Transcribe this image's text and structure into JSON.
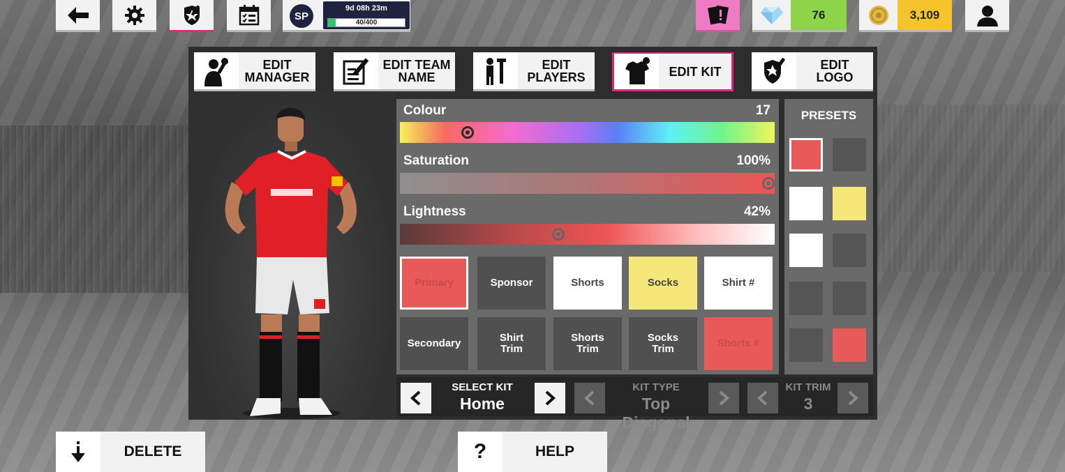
{
  "topbar": {
    "season_badge": "SP",
    "season_time": "9d 08h 23m",
    "season_progress_text": "40/400",
    "season_progress_fraction": 0.1,
    "gems": "76",
    "coins": "3,109"
  },
  "tabs": [
    {
      "label": "EDIT\nMANAGER",
      "icon": "manager-wrench-icon"
    },
    {
      "label": "EDIT TEAM\nNAME",
      "icon": "edit-document-icon"
    },
    {
      "label": "EDIT\nPLAYERS",
      "icon": "players-wrench-icon"
    },
    {
      "label": "EDIT KIT",
      "icon": "kit-wrench-icon",
      "active": true
    },
    {
      "label": "EDIT\nLOGO",
      "icon": "logo-wrench-icon"
    }
  ],
  "sliders": {
    "colour": {
      "label": "Colour",
      "value": "17",
      "fraction": 0.17
    },
    "saturation": {
      "label": "Saturation",
      "value": "100%",
      "fraction": 1.0
    },
    "lightness": {
      "label": "Lightness",
      "value": "42%",
      "fraction": 0.42
    }
  },
  "kit_parts": [
    {
      "label": "Primary",
      "color": "#e85a5a",
      "text_color": "#c94a4a",
      "selected": true
    },
    {
      "label": "Sponsor",
      "color": "#505050",
      "text_color": "#ffffff"
    },
    {
      "label": "Shorts",
      "color": "#ffffff",
      "text_color": "#444444"
    },
    {
      "label": "Socks",
      "color": "#f5e77a",
      "text_color": "#444444"
    },
    {
      "label": "Shirt #",
      "color": "#ffffff",
      "text_color": "#444444"
    },
    {
      "label": "Secondary",
      "color": "#505050",
      "text_color": "#ffffff"
    },
    {
      "label": "Shirt\nTrim",
      "color": "#505050",
      "text_color": "#ffffff"
    },
    {
      "label": "Shorts\nTrim",
      "color": "#505050",
      "text_color": "#ffffff"
    },
    {
      "label": "Socks\nTrim",
      "color": "#505050",
      "text_color": "#ffffff"
    },
    {
      "label": "Shorts #",
      "color": "#e85a5a",
      "text_color": "#c94a4a"
    }
  ],
  "presets": {
    "title": "PRESETS",
    "swatches": [
      "#e85a5a",
      "#555555",
      "#ffffff",
      "#f5e77a",
      "#ffffff",
      "#555555",
      "#555555",
      "#555555",
      "#555555",
      "#e85a5a"
    ]
  },
  "kit_selector": {
    "select_kit_caption": "SELECT KIT",
    "select_kit_value": "Home",
    "kit_type_caption": "KIT TYPE",
    "kit_type_value": "Top Diagonal",
    "kit_trim_caption": "KIT TRIM",
    "kit_trim_value": "3"
  },
  "actions": {
    "delete_label": "DELETE",
    "help_icon": "?",
    "help_label": "HELP"
  },
  "colors": {
    "accent_pink": "#e0287d",
    "kit_red": "#e85a5a",
    "gem_green": "#8ed44a",
    "coin_yellow": "#f5c42c"
  }
}
